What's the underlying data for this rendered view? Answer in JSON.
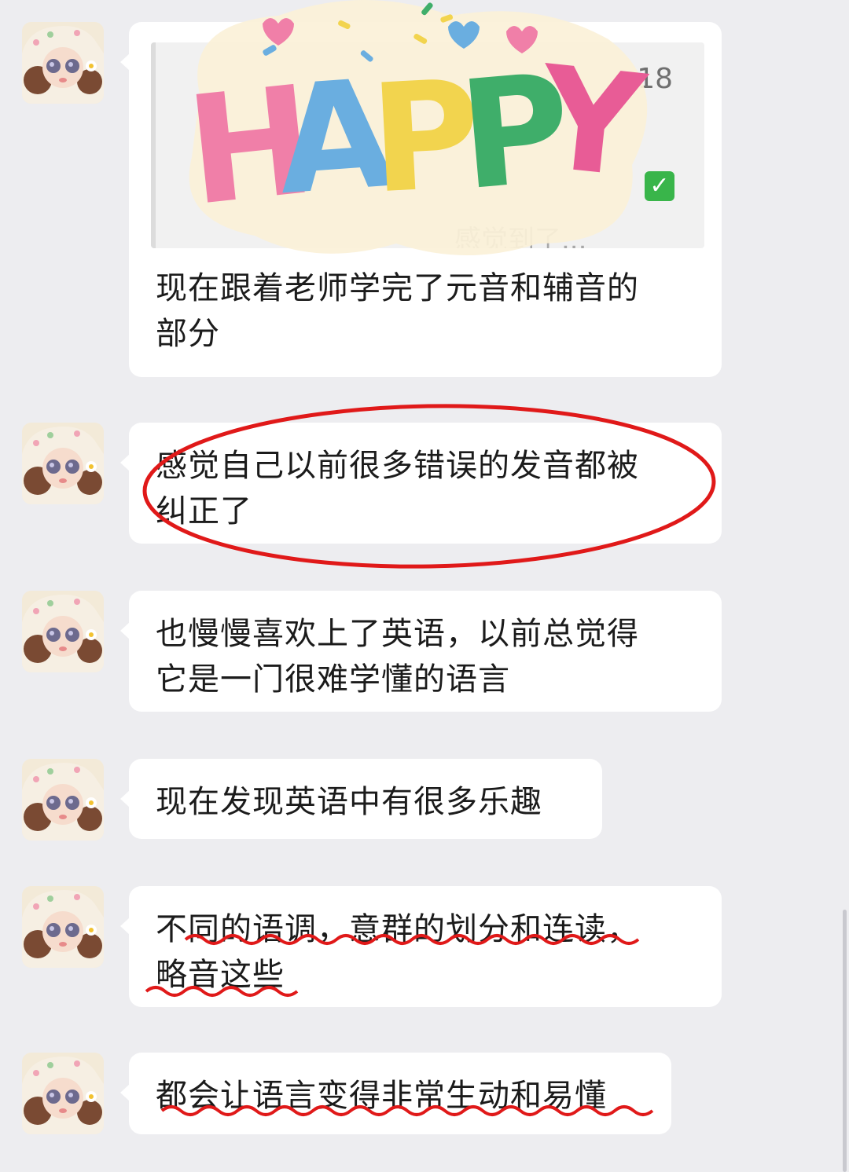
{
  "messages": [
    {
      "quote": {
        "time": "18",
        "snippet": "感觉到了...",
        "check_icon": "check-box-icon"
      },
      "text": "现在跟着老师学完了元音和辅音的\n部分"
    },
    {
      "text": "感觉自己以前很多错误的发音都被\n纠正了"
    },
    {
      "text": "也慢慢喜欢上了英语，以前总觉得\n它是一门很难学懂的语言"
    },
    {
      "text": "现在发现英语中有很多乐趣"
    },
    {
      "text": "不同的语调，意群的划分和连读，\n略音这些"
    },
    {
      "text": "都会让语言变得非常生动和易懂"
    }
  ],
  "sticker": {
    "word": "HAPPY",
    "letters": [
      "H",
      "A",
      "P",
      "P",
      "Y"
    ],
    "letter_colors": [
      "#f07fa8",
      "#6aaee0",
      "#f2d44e",
      "#3fae6a",
      "#e85c96"
    ]
  },
  "annotations": {
    "ellipse_color": "#e01919",
    "underline_color": "#e01919"
  },
  "colors": {
    "background": "#ededf0",
    "bubble": "#ffffff",
    "text": "#1b1b1b"
  }
}
